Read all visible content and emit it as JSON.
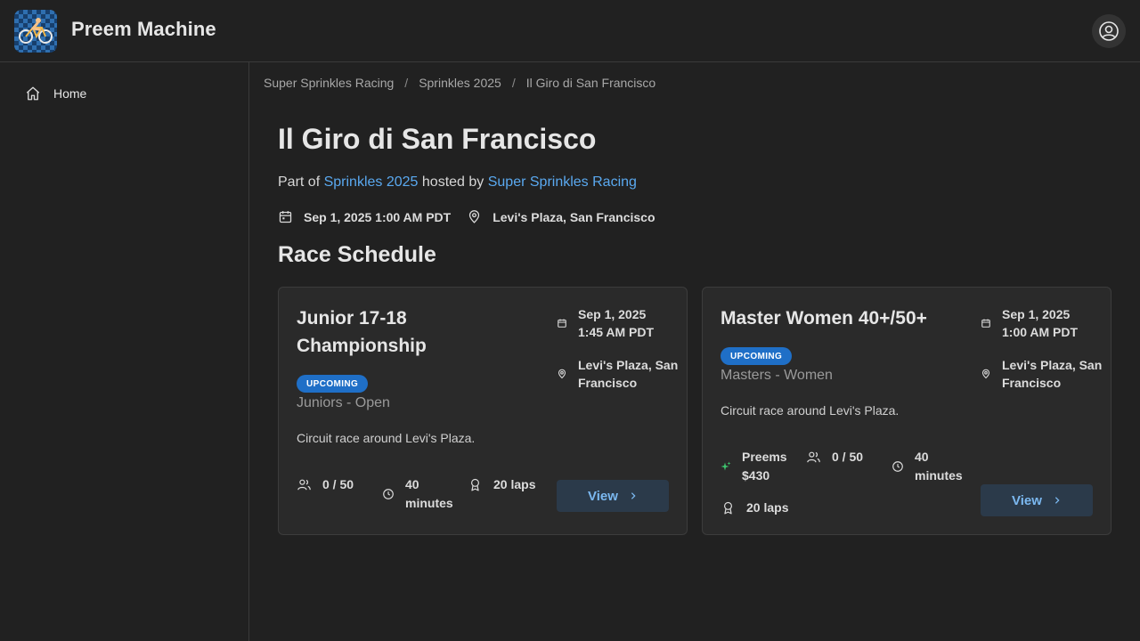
{
  "app": {
    "title": "Preem Machine"
  },
  "sidebar": {
    "items": [
      {
        "label": "Home"
      }
    ]
  },
  "breadcrumb": [
    "Super Sprinkles Racing",
    "Sprinkles 2025",
    "Il Giro di San Francisco"
  ],
  "event": {
    "title": "Il Giro di San Francisco",
    "part_of_prefix": "Part of",
    "series_link": "Sprinkles 2025",
    "hosted_by_text": "hosted by",
    "host_link": "Super Sprinkles Racing",
    "date": "Sep 1, 2025 1:00 AM PDT",
    "location": "Levi's Plaza, San Francisco"
  },
  "schedule": {
    "title": "Race Schedule",
    "races": [
      {
        "title": "Junior 17-18 Championship",
        "status": "UPCOMING",
        "category": "Juniors - Open",
        "description": "Circuit race around Levi's Plaza.",
        "date_line1": "Sep 1, 2025",
        "date_line2": "1:45 AM PDT",
        "location": "Levi's Plaza, San Francisco",
        "riders": "0 / 50",
        "duration": "40 minutes",
        "laps": "20 laps",
        "view_label": "View"
      },
      {
        "title": "Master Women 40+/50+",
        "status": "UPCOMING",
        "category": "Masters - Women",
        "description": "Circuit race around Levi's Plaza.",
        "date_line1": "Sep 1, 2025",
        "date_line2": "1:00 AM PDT",
        "location": "Levi's Plaza, San Francisco",
        "preems": "Preems $430",
        "riders": "0 / 50",
        "duration": "40 minutes",
        "laps": "20 laps",
        "view_label": "View"
      }
    ]
  },
  "colors": {
    "background": "#212121",
    "card": "#2a2a2a",
    "accent": "#5aa9f0",
    "badge": "#1f6fc7",
    "preem_icon": "#3ec46d"
  }
}
